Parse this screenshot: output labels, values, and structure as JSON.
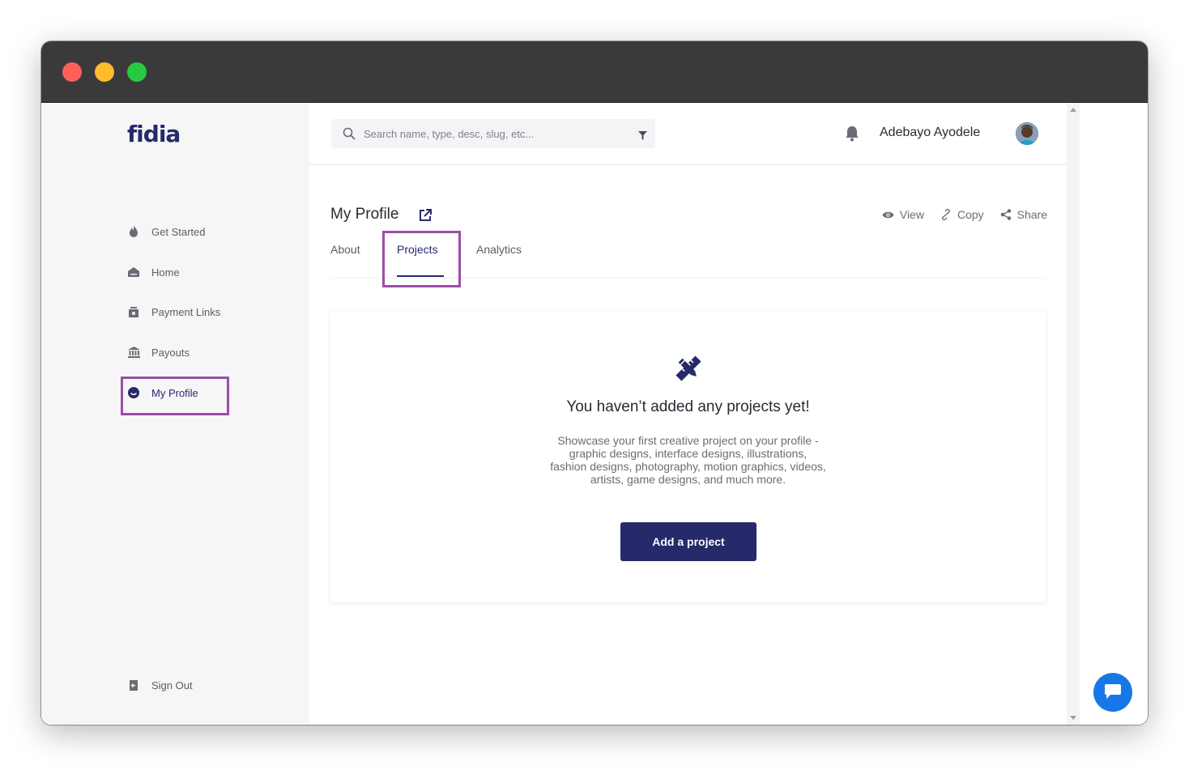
{
  "app": {
    "logo": "fidia"
  },
  "sidebar": {
    "items": [
      {
        "label": "Get Started",
        "icon": "rocket-icon"
      },
      {
        "label": "Home",
        "icon": "home-icon"
      },
      {
        "label": "Payment Links",
        "icon": "link-icon"
      },
      {
        "label": "Payouts",
        "icon": "bank-icon"
      },
      {
        "label": "My Profile",
        "icon": "profile-icon",
        "active": true
      }
    ],
    "sign_out": {
      "label": "Sign Out",
      "icon": "sign-out-icon"
    }
  },
  "header": {
    "search": {
      "placeholder": "Search name, type, desc, slug, etc...",
      "value": ""
    },
    "user_name": "Adebayo Ayodele"
  },
  "profile": {
    "title": "My Profile",
    "actions": [
      {
        "label": "View",
        "icon": "eye-icon"
      },
      {
        "label": "Copy",
        "icon": "link-icon"
      },
      {
        "label": "Share",
        "icon": "share-icon"
      }
    ],
    "tabs": [
      {
        "label": "About"
      },
      {
        "label": "Projects",
        "active": true
      },
      {
        "label": "Analytics"
      }
    ]
  },
  "empty_state": {
    "icon": "design-tools-icon",
    "title": "You haven’t added any projects yet!",
    "description": "Showcase your first creative project on your profile - graphic designs, interface designs, illustrations, fashion designs, photography, motion graphics, videos, artists, game designs, and much more.",
    "button_label": "Add a project"
  },
  "colors": {
    "brand": "#262a6b",
    "highlight": "#9b4ea8",
    "chat": "#1877e6"
  }
}
